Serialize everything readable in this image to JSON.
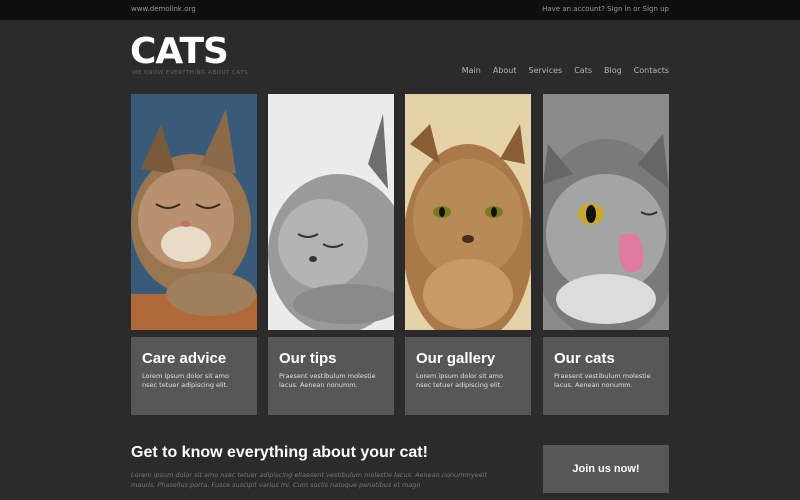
{
  "topbar": {
    "domain": "www.demolink.org",
    "account_prefix": "Have an account?",
    "signin": "Sign in",
    "or": "or",
    "signup": "Sign up"
  },
  "brand": {
    "logo": "CATS",
    "tagline": "WE KNOW EVERYTHING ABOUT CATS"
  },
  "nav": {
    "items": [
      "Main",
      "About",
      "Services",
      "Cats",
      "Blog",
      "Contacts"
    ]
  },
  "cards": [
    {
      "title": "Care advice",
      "text": "Lorem ipsum dolor sit amo nsec tetuer adipiscing elit."
    },
    {
      "title": "Our tips",
      "text": "Praesent vestibulum molestie lacus. Aenean nonumm."
    },
    {
      "title": "Our gallery",
      "text": "Lorem ipsum dolor sit amo nsec tetuer adipiscing elit."
    },
    {
      "title": "Our cats",
      "text": "Praesent vestibulum molestie lacus. Aenean nonumm."
    }
  ],
  "main": {
    "headline": "Get to know everything about your cat!",
    "body": "Lorem ipsum dolor sit amo nsec tetuer adipiscing eliaesent vestibulum molestie lacus. Aenean nonummyeeit mauris. Phasellus porta. Fusce suscipit varius mi. Cum sociis natoque penatibus et magn"
  },
  "cta": {
    "label": "Join us now!"
  },
  "colors": {
    "background": "#2b2b2b",
    "topbar": "#0f0f0f",
    "card_box": "#575757"
  }
}
